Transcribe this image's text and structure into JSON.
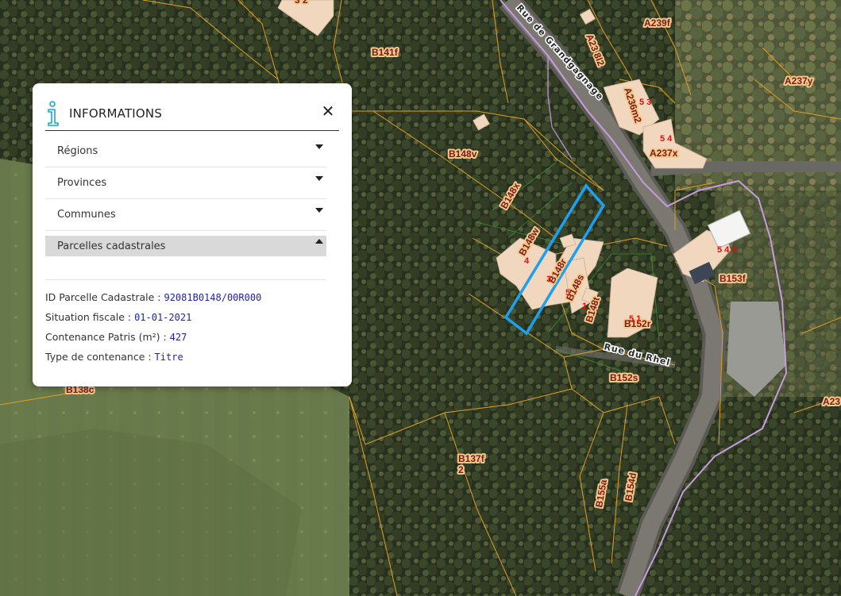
{
  "panel": {
    "title": "INFORMATIONS",
    "close_label": "✕",
    "sections": [
      {
        "label": "Régions",
        "open": false
      },
      {
        "label": "Provinces",
        "open": false
      },
      {
        "label": "Communes",
        "open": false
      },
      {
        "label": "Parcelles cadastrales",
        "open": true
      }
    ],
    "attributes": [
      {
        "label": "ID Parcelle Cadastrale : ",
        "value": "92081B0148/00R000"
      },
      {
        "label": "Situation fiscale : ",
        "value": "01-01-2021"
      },
      {
        "label": "Contenance Patris (m²) : ",
        "value": "427"
      },
      {
        "label": "Type de contenance : ",
        "value": "Titre"
      }
    ]
  },
  "map": {
    "parcel_labels": [
      "B141f",
      "A239f",
      "A23 8l2",
      "A236m2",
      "A237y",
      "A237x",
      "B148v",
      "B148x",
      "B148w",
      "B148r",
      "B148s",
      "B148t",
      "B152r",
      "B153f",
      "B152s",
      "B137f",
      "2",
      "B155a",
      "B154d",
      "B138c",
      "A23",
      "3 2"
    ],
    "house_numbers": [
      "5 3",
      "5 4",
      "5 4 A",
      "4",
      "3",
      "5",
      "1",
      "5 1"
    ],
    "streets": [
      "Rue de Grandgagnage",
      "Rue du Rhel"
    ],
    "colors": {
      "parcel_boundary": "#e0a020",
      "selection": "#1ea0f0",
      "commune_boundary": "#c79be0",
      "building": "#f1d7bd"
    }
  }
}
